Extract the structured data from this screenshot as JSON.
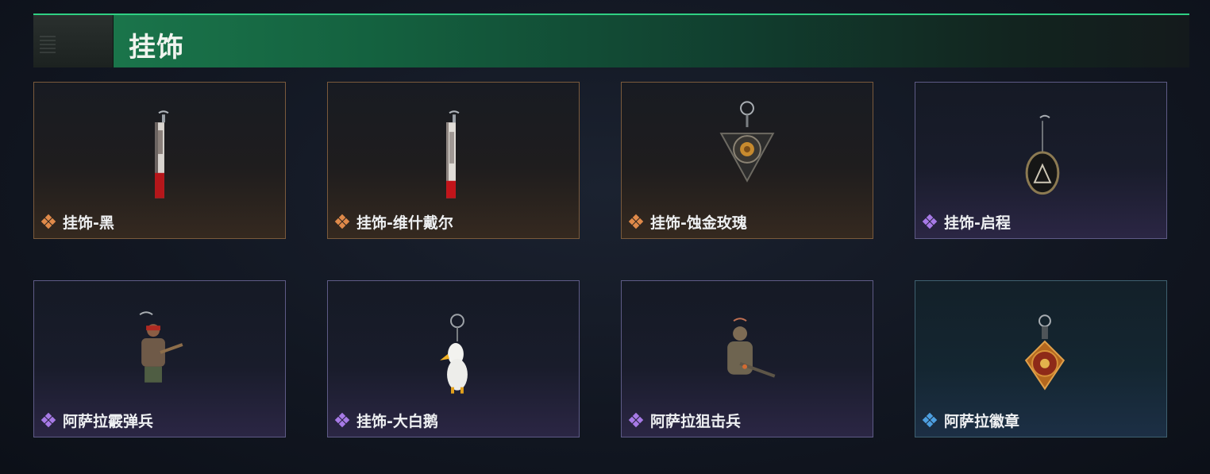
{
  "section": {
    "title": "挂饰"
  },
  "colors": {
    "orange": "#e08a4a",
    "purple": "#a77ae6",
    "blue": "#4d9fe0",
    "accent": "#2fd083"
  },
  "items": [
    {
      "label": "挂饰-黑",
      "rarity": "orange",
      "icon": "cleaver-charm-icon"
    },
    {
      "label": "挂饰-维什戴尔",
      "rarity": "orange",
      "icon": "cleaver-charm-icon"
    },
    {
      "label": "挂饰-蚀金玫瑰",
      "rarity": "orange",
      "icon": "rose-emblem-charm-icon"
    },
    {
      "label": "挂饰-启程",
      "rarity": "purple",
      "icon": "triangle-medal-charm-icon"
    },
    {
      "label": "阿萨拉霰弹兵",
      "rarity": "purple",
      "icon": "shotgunner-figure-charm-icon"
    },
    {
      "label": "挂饰-大白鹅",
      "rarity": "purple",
      "icon": "white-goose-charm-icon"
    },
    {
      "label": "阿萨拉狙击兵",
      "rarity": "purple",
      "icon": "sniper-figure-charm-icon"
    },
    {
      "label": "阿萨拉徽章",
      "rarity": "blue",
      "icon": "badge-medal-charm-icon"
    }
  ]
}
